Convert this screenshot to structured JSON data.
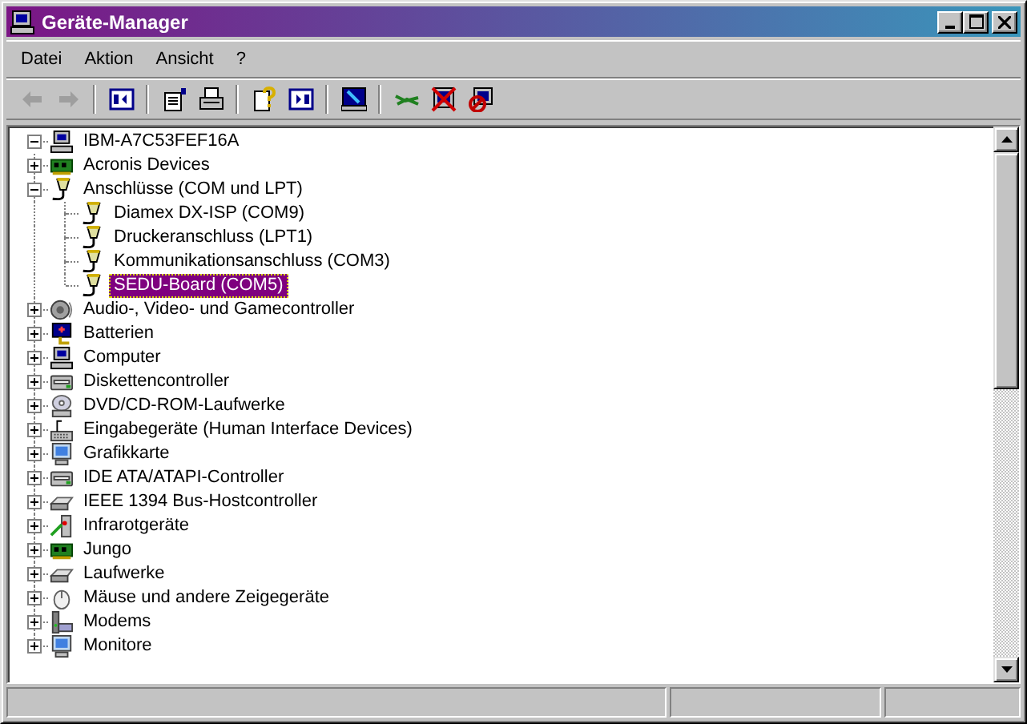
{
  "window": {
    "title": "Geräte-Manager"
  },
  "menu": [
    {
      "label": "Datei"
    },
    {
      "label": "Aktion"
    },
    {
      "label": "Ansicht"
    },
    {
      "label": "?"
    }
  ],
  "toolbar": {
    "groups": [
      {
        "buttons": [
          {
            "disabled": true
          },
          {
            "disabled": true
          }
        ]
      },
      {
        "buttons": [
          {
            "disabled": false
          }
        ]
      },
      {
        "buttons": [
          {
            "disabled": false
          },
          {
            "disabled": false
          }
        ]
      },
      {
        "buttons": [
          {
            "disabled": false
          },
          {
            "disabled": false
          }
        ]
      },
      {
        "buttons": [
          {
            "disabled": false
          }
        ]
      },
      {
        "buttons": [
          {
            "disabled": false
          },
          {
            "disabled": false
          },
          {
            "disabled": false
          }
        ]
      }
    ]
  },
  "tree": {
    "label": "IBM-A7C53FEF16A",
    "expanded": true,
    "selected": false,
    "children": [
      {
        "label": "Acronis Devices",
        "expanded": false,
        "selected": false
      },
      {
        "label": "Anschlüsse (COM und LPT)",
        "expanded": true,
        "selected": false,
        "children": [
          {
            "label": "Diamex DX-ISP (COM9)",
            "selected": false
          },
          {
            "label": "Druckeranschluss (LPT1)",
            "selected": false
          },
          {
            "label": "Kommunikationsanschluss (COM3)",
            "selected": false
          },
          {
            "label": "SEDU-Board (COM5)",
            "selected": true
          }
        ]
      },
      {
        "label": "Audio-, Video- und Gamecontroller",
        "expanded": false,
        "selected": false
      },
      {
        "label": "Batterien",
        "expanded": false,
        "selected": false
      },
      {
        "label": "Computer",
        "expanded": false,
        "selected": false
      },
      {
        "label": "Diskettencontroller",
        "expanded": false,
        "selected": false
      },
      {
        "label": "DVD/CD-ROM-Laufwerke",
        "expanded": false,
        "selected": false
      },
      {
        "label": "Eingabegeräte (Human Interface Devices)",
        "expanded": false,
        "selected": false
      },
      {
        "label": "Grafikkarte",
        "expanded": false,
        "selected": false
      },
      {
        "label": "IDE ATA/ATAPI-Controller",
        "expanded": false,
        "selected": false
      },
      {
        "label": "IEEE 1394 Bus-Hostcontroller",
        "expanded": false,
        "selected": false
      },
      {
        "label": "Infrarotgeräte",
        "expanded": false,
        "selected": false
      },
      {
        "label": "Jungo",
        "expanded": false,
        "selected": false
      },
      {
        "label": "Laufwerke",
        "expanded": false,
        "selected": false
      },
      {
        "label": "Mäuse und andere Zeigegeräte",
        "expanded": false,
        "selected": false
      },
      {
        "label": "Modems",
        "expanded": false,
        "selected": false
      },
      {
        "label": "Monitore",
        "expanded": false,
        "selected": false
      }
    ]
  }
}
